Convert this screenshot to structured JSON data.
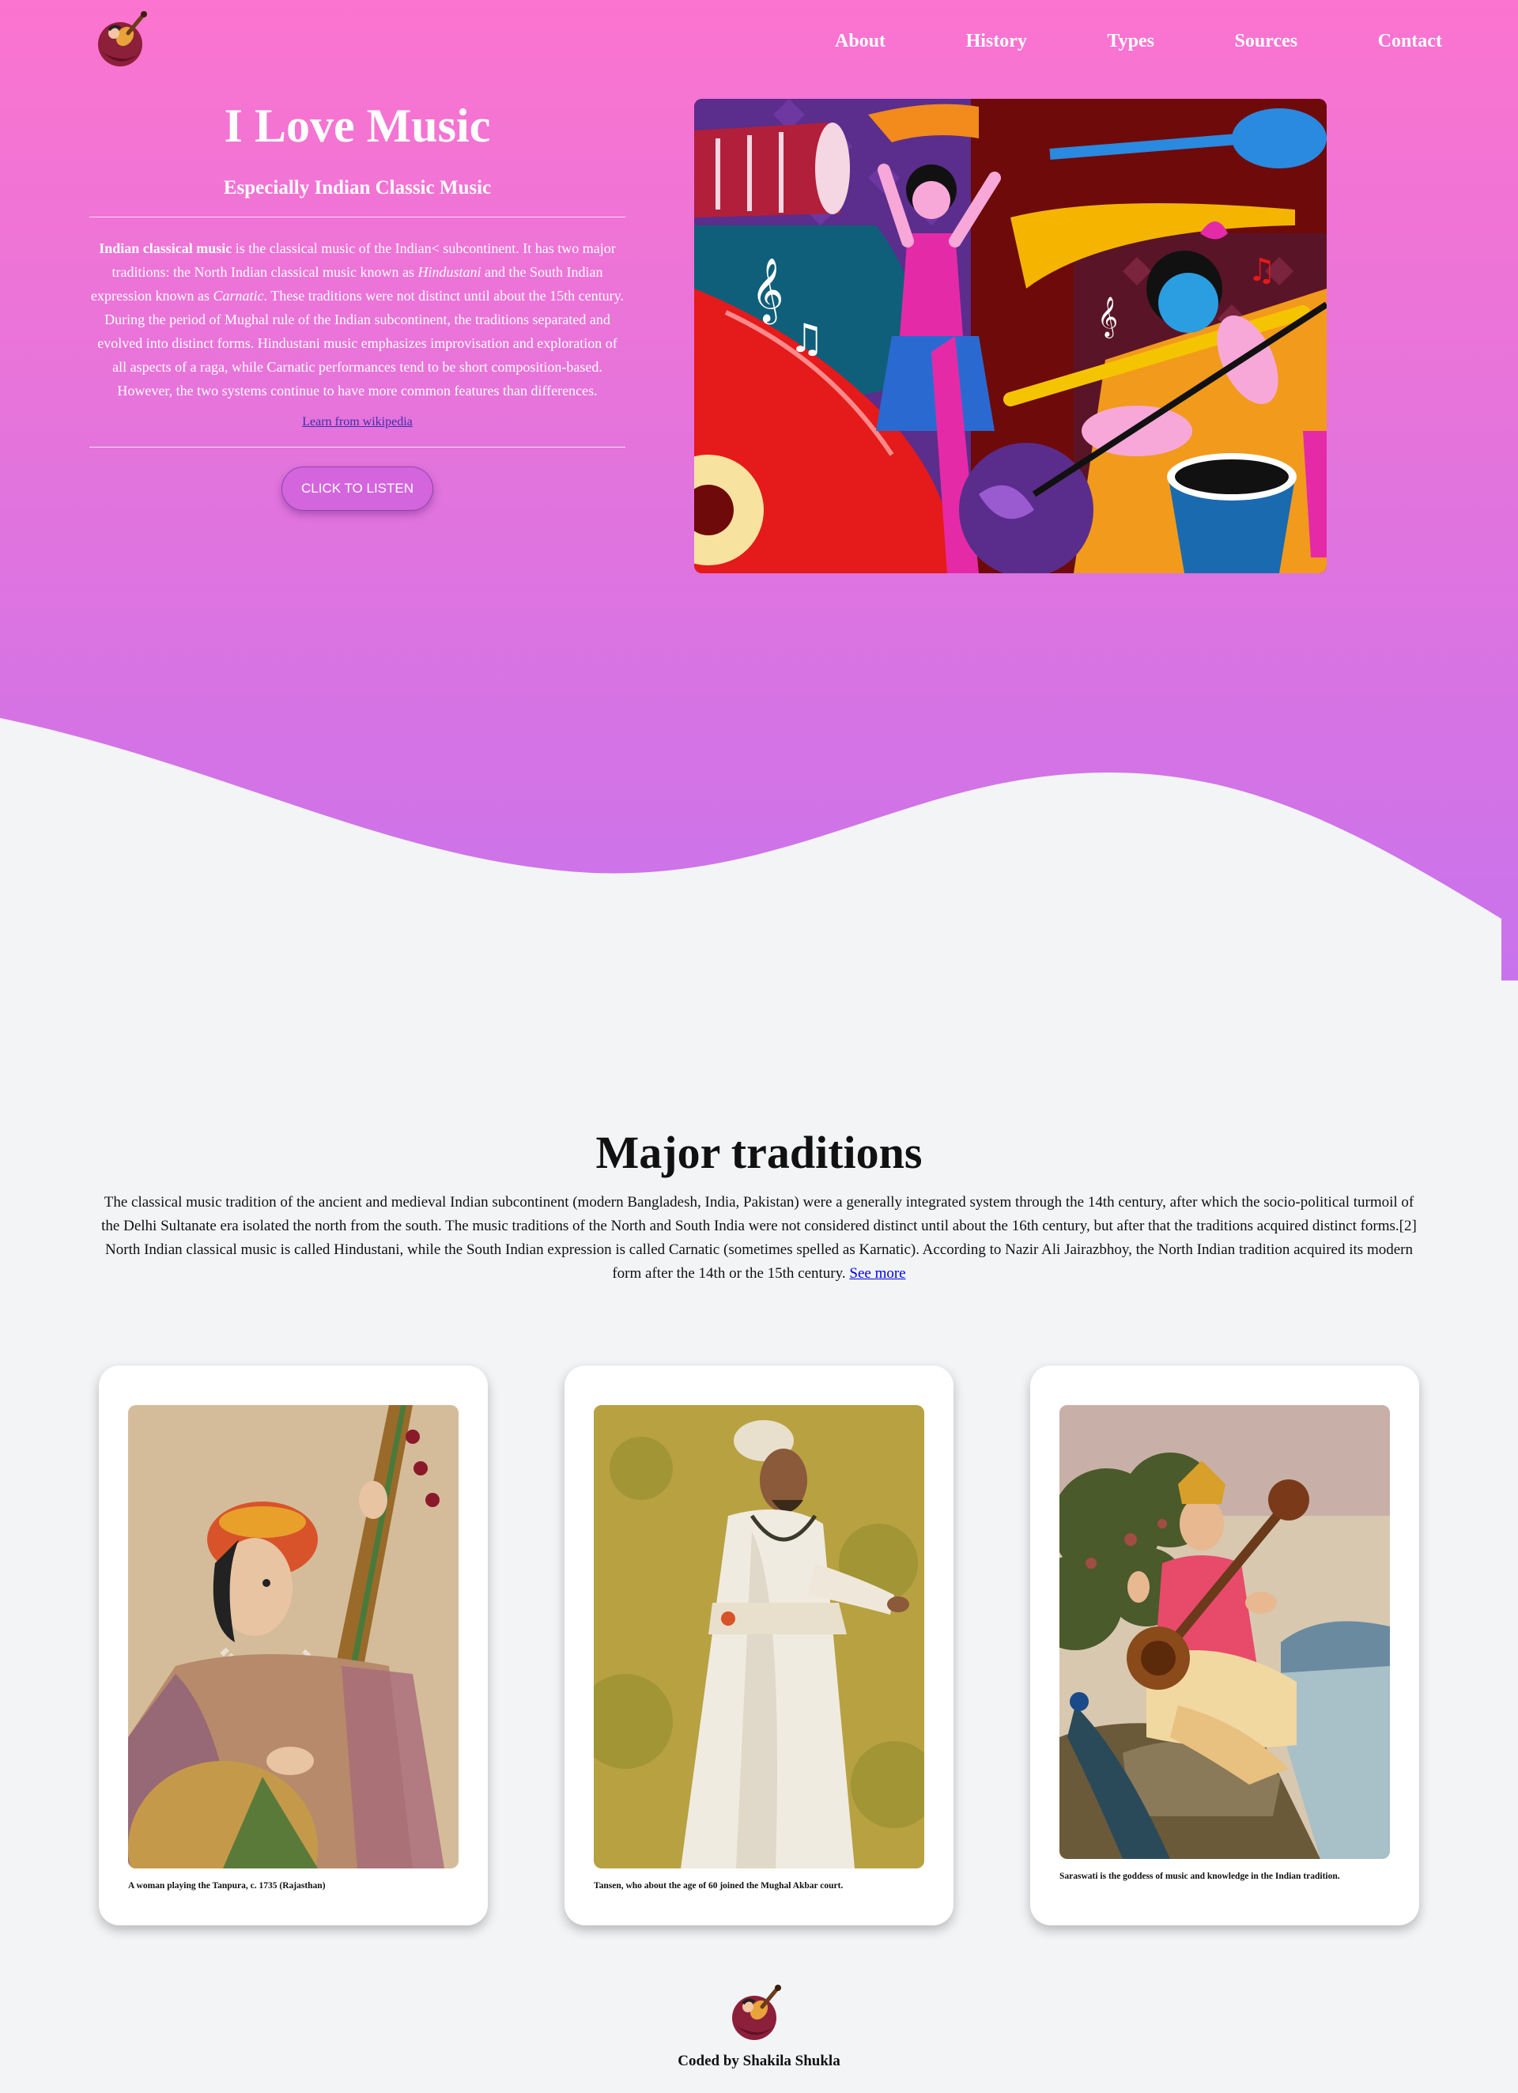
{
  "nav": {
    "items": [
      "About",
      "History",
      "Types",
      "Sources",
      "Contact"
    ]
  },
  "intro": {
    "title": "I Love Music",
    "subtitle": "Especially Indian Classic Music",
    "paragraph": {
      "lead": "Indian classical music",
      "part1": " is the classical music of the Indian< subcontinent. It has two major traditions: the North Indian classical music known as ",
      "hindustani": "Hindustani",
      "part2": " and the South Indian expression known as ",
      "carnatic": "Carnatic",
      "part3": ". These traditions were not distinct until about the 15th century. During the period of Mughal rule of the Indian subcontinent, the traditions separated and evolved into distinct forms. Hindustani music emphasizes improvisation and exploration of all aspects of a raga, while Carnatic performances tend to be short composition-based. However, the two systems continue to have more common features than differences."
    },
    "wiki_link": "Learn from wikipedia",
    "listen_button": "CLICK TO LISTEN"
  },
  "traditions": {
    "title": "Major traditions",
    "text": "The classical music tradition of the ancient and medieval Indian subcontinent (modern Bangladesh, India, Pakistan) were a generally integrated system through the 14th century, after which the socio-political turmoil of the Delhi Sultanate era isolated the north from the south. The music traditions of the North and South India were not considered distinct until about the 16th century, but after that the traditions acquired distinct forms.[2] North Indian classical music is called Hindustani, while the South Indian expression is called Carnatic (sometimes spelled as Karnatic). According to Nazir Ali Jairazbhoy, the North Indian tradition acquired its modern form after the 14th or the 15th century.",
    "see_more": "See more"
  },
  "cards": [
    {
      "caption": "A woman playing the Tanpura, c. 1735 (Rajasthan)"
    },
    {
      "caption": "Tansen, who about the age of 60 joined the Mughal Akbar court."
    },
    {
      "caption": "Saraswati is the goddess of music and knowledge in the Indian tradition."
    }
  ],
  "footer": {
    "credit": "Coded by Shakila Shukla"
  },
  "colors": {
    "hero_top": "#fb74cf",
    "hero_bottom": "#c873ec",
    "page_bg": "#f3f4f6"
  },
  "icons": {
    "logo": "guitar-heart-logo-icon"
  }
}
